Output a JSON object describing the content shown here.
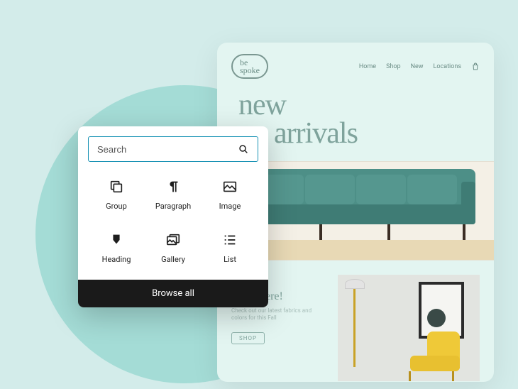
{
  "site": {
    "logo_line1": "be",
    "logo_line2": "spoke",
    "nav": {
      "home": "Home",
      "shop": "Shop",
      "new": "New",
      "locations": "Locations"
    },
    "hero": {
      "line1": "new",
      "line2": "arrivals"
    },
    "promo": {
      "heading": "fall is here!",
      "sub": "Check out our latest fabrics and colors for this Fall",
      "cta": "SHOP"
    }
  },
  "inserter": {
    "search_placeholder": "Search",
    "blocks": {
      "group": "Group",
      "paragraph": "Paragraph",
      "image": "Image",
      "heading": "Heading",
      "gallery": "Gallery",
      "list": "List"
    },
    "browse_all": "Browse all"
  }
}
